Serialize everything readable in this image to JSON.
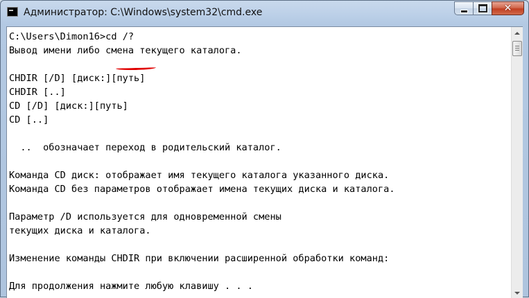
{
  "window": {
    "title": "Администратор: C:\\Windows\\system32\\cmd.exe",
    "icon": "cmd-icon",
    "controls": {
      "minimize": "minimize-icon",
      "maximize": "maximize-icon",
      "close": "close-icon",
      "close_glyph": "✕"
    }
  },
  "console": {
    "prompt": "C:\\Users\\Dimon16>",
    "command": "cd /?",
    "highlight_color": "#e00000",
    "lines": [
      "Вывод имени либо смена текущего каталога.",
      "",
      "CHDIR [/D] [диск:][путь]",
      "CHDIR [..]",
      "CD [/D] [диск:][путь]",
      "CD [..]",
      "",
      "  ..  обозначает переход в родительский каталог.",
      "",
      "Команда CD диск: отображает имя текущего каталога указанного диска.",
      "Команда CD без параметров отображает имена текущих диска и каталога.",
      "",
      "Параметр /D используется для одновременной смены",
      "текущих диска и каталога.",
      "",
      "Изменение команды CHDIR при включении расширенной обработки команд:",
      "",
      "Для продолжения нажмите любую клавишу . . ."
    ]
  }
}
